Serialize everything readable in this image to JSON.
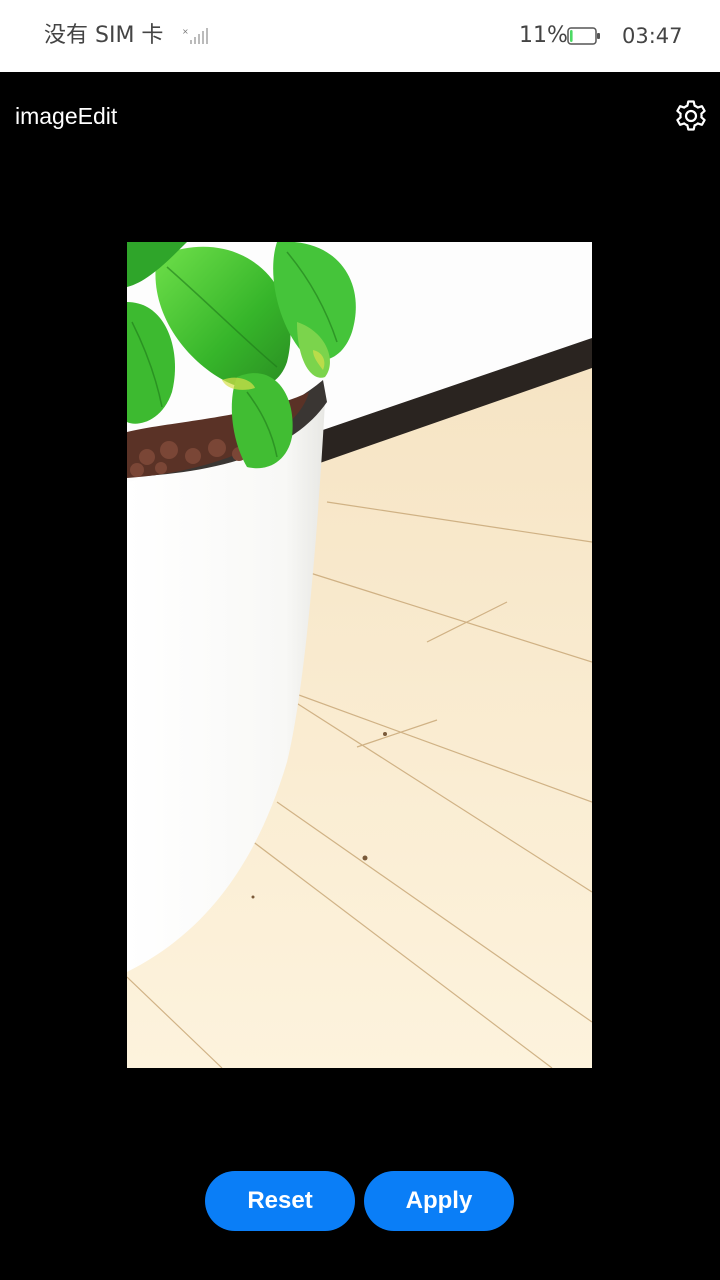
{
  "status_bar": {
    "carrier": "没有 SIM 卡",
    "battery_percent": "11%",
    "battery_level": 0.11,
    "time": "03:47",
    "signal_icon": "signal-bars-icon",
    "battery_icon": "battery-icon"
  },
  "header": {
    "title": "imageEdit",
    "settings_icon": "gear-icon"
  },
  "photo": {
    "subject": "potted-plant-photo"
  },
  "actions": {
    "reset_label": "Reset",
    "apply_label": "Apply"
  },
  "colors": {
    "accent": "#0a7ef7",
    "background": "#000000",
    "status_bar_bg": "#ffffff",
    "battery_fill": "#4cd964"
  }
}
